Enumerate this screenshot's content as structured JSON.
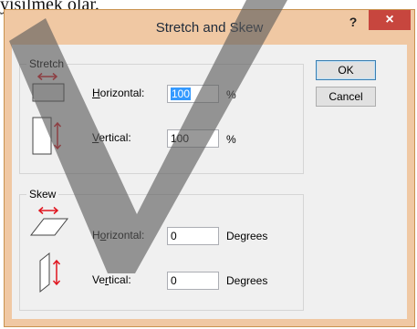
{
  "background_text": "yişilmek olar.",
  "window": {
    "title": "Stretch and Skew",
    "help": "?",
    "close": "×"
  },
  "stretch": {
    "group_title": "Stretch",
    "horizontal_label_first": "H",
    "horizontal_label_rest": "orizontal:",
    "horizontal_value": "100",
    "horizontal_unit": "%",
    "vertical_label_first": "V",
    "vertical_label_rest": "ertical:",
    "vertical_value": "100",
    "vertical_unit": "%"
  },
  "skew": {
    "group_title": "Skew",
    "horizontal_label_pre": "H",
    "horizontal_label_mid": "o",
    "horizontal_label_rest": "rizontal:",
    "horizontal_value": "0",
    "horizontal_unit": "Degrees",
    "vertical_label_pre": "Ve",
    "vertical_label_mid": "r",
    "vertical_label_rest": "tical:",
    "vertical_value": "0",
    "vertical_unit": "Degrees"
  },
  "buttons": {
    "ok": "OK",
    "cancel": "Cancel"
  },
  "colors": {
    "frame": "#f0c8a3",
    "close": "#c7463e",
    "arrow": "#e0141e",
    "watermark": "#5a5a5a"
  }
}
